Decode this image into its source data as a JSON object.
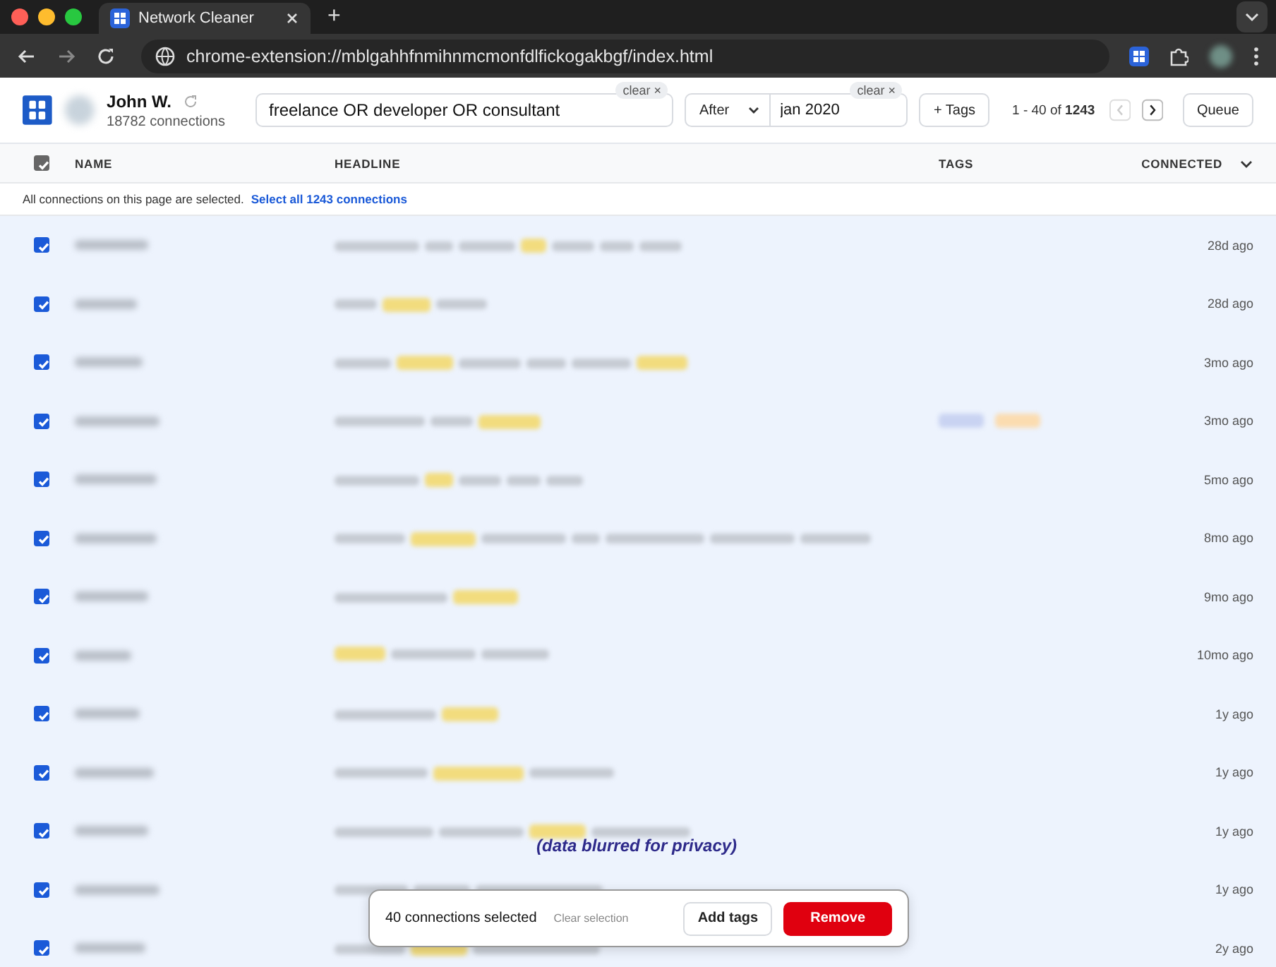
{
  "browser": {
    "tab_title": "Network Cleaner",
    "new_tab": "+",
    "url": "chrome-extension://mblgahhfnmihnmcmonfdlfickogakbgf/index.html"
  },
  "header": {
    "user_name": "John W.",
    "connections": "18782 connections",
    "search": {
      "value": "freelance OR developer OR consultant",
      "clear": "clear ×"
    },
    "date_filter": {
      "mode": "After",
      "value": "jan 2020",
      "clear": "clear ×"
    },
    "tags_button": "+ Tags",
    "range": "1 - 40 of ",
    "total": "1243",
    "queue_button": "Queue"
  },
  "table": {
    "all_checked": true,
    "columns": [
      "NAME",
      "HEADLINE",
      "TAGS",
      "CONNECTED"
    ],
    "banner": {
      "text": "All connections on this page are selected.",
      "link": "Select all 1243 connections"
    },
    "rows": [
      {
        "checked": true,
        "connected": "28d ago"
      },
      {
        "checked": true,
        "connected": "28d ago"
      },
      {
        "checked": true,
        "connected": "3mo ago"
      },
      {
        "checked": true,
        "connected": "3mo ago",
        "tags": [
          {
            "color": "#c9d3f2"
          },
          {
            "color": "#fbdcb0"
          }
        ]
      },
      {
        "checked": true,
        "connected": "5mo ago"
      },
      {
        "checked": true,
        "connected": "8mo ago"
      },
      {
        "checked": true,
        "connected": "9mo ago"
      },
      {
        "checked": true,
        "connected": "10mo ago"
      },
      {
        "checked": true,
        "connected": "1y ago"
      },
      {
        "checked": true,
        "connected": "1y ago"
      },
      {
        "checked": true,
        "connected": "1y ago"
      },
      {
        "checked": true,
        "connected": "1y ago"
      },
      {
        "checked": true,
        "connected": "2y ago"
      }
    ]
  },
  "privacy_note": "(data blurred for privacy)",
  "action_bar": {
    "count": "40 connections selected",
    "clear": "Clear selection",
    "add_tags": "Add tags",
    "remove": "Remove"
  }
}
